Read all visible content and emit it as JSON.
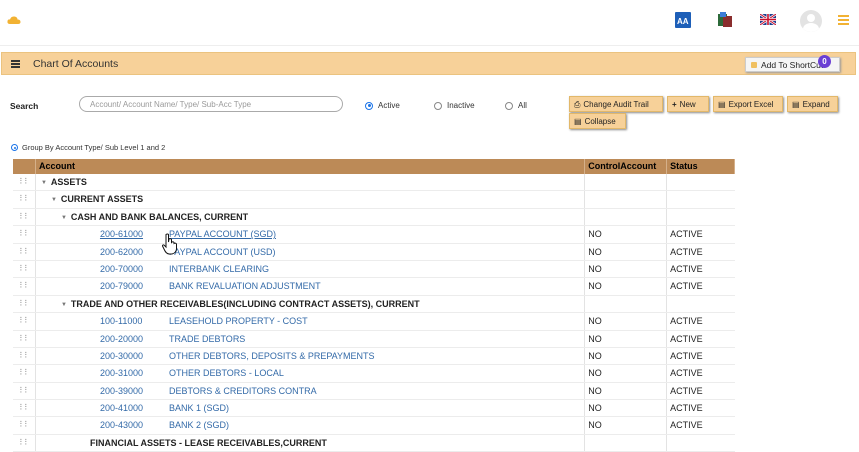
{
  "header": {
    "icons": [
      "cloud-logo-icon",
      "text-size-icon",
      "ledger-book-icon",
      "uk-flag-icon",
      "user-avatar-icon",
      "menu-icon"
    ]
  },
  "titlebar": {
    "title": "Chart Of Accounts",
    "shortcut_label": "Add To ShortCut",
    "shortcut_badge": "0"
  },
  "search": {
    "label": "Search",
    "placeholder": "Account/ Account Name/ Type/ Sub-Acc Type",
    "options": [
      "Active",
      "Inactive",
      "All"
    ],
    "selected": "Active"
  },
  "actions": {
    "audit": "Change Audit Trail",
    "new": "New",
    "export": "Export Excel",
    "expand": "Expand",
    "collapse": "Collapse"
  },
  "groupby": "Group By Account Type/ Sub Level 1 and 2",
  "table": {
    "headers": [
      "Account",
      "ControlAccount",
      "Status"
    ],
    "rows": [
      {
        "level": 0,
        "group": true,
        "label": "ASSETS"
      },
      {
        "level": 1,
        "group": true,
        "label": "CURRENT ASSETS"
      },
      {
        "level": 2,
        "group": true,
        "label": "CASH AND BANK BALANCES, CURRENT"
      },
      {
        "level": 3,
        "code": "200-61000",
        "name": "PAYPAL ACCOUNT (SGD)",
        "control": "NO",
        "status": "ACTIVE"
      },
      {
        "level": 3,
        "code": "200-62000",
        "name": "PAYPAL ACCOUNT (USD)",
        "control": "NO",
        "status": "ACTIVE"
      },
      {
        "level": 3,
        "code": "200-70000",
        "name": "INTERBANK CLEARING",
        "control": "NO",
        "status": "ACTIVE"
      },
      {
        "level": 3,
        "code": "200-79000",
        "name": "BANK REVALUATION ADJUSTMENT",
        "control": "NO",
        "status": "ACTIVE"
      },
      {
        "level": 2,
        "group": true,
        "label": "TRADE AND OTHER RECEIVABLES(INCLUDING CONTRACT ASSETS), CURRENT"
      },
      {
        "level": 3,
        "code": "100-11000",
        "name": "LEASEHOLD PROPERTY - COST",
        "control": "NO",
        "status": "ACTIVE"
      },
      {
        "level": 3,
        "code": "200-20000",
        "name": "TRADE DEBTORS",
        "control": "NO",
        "status": "ACTIVE"
      },
      {
        "level": 3,
        "code": "200-30000",
        "name": "OTHER DEBTORS, DEPOSITS & PREPAYMENTS",
        "control": "NO",
        "status": "ACTIVE"
      },
      {
        "level": 3,
        "code": "200-31000",
        "name": "OTHER DEBTORS - LOCAL",
        "control": "NO",
        "status": "ACTIVE"
      },
      {
        "level": 3,
        "code": "200-39000",
        "name": "DEBTORS & CREDITORS CONTRA",
        "control": "NO",
        "status": "ACTIVE"
      },
      {
        "level": 3,
        "code": "200-41000",
        "name": "BANK 1 (SGD)",
        "control": "NO",
        "status": "ACTIVE"
      },
      {
        "level": 3,
        "code": "200-43000",
        "name": "BANK 2 (SGD)",
        "control": "NO",
        "status": "ACTIVE"
      },
      {
        "level": 2,
        "group": true,
        "nocaret": true,
        "label": "FINANCIAL ASSETS - LEASE RECEIVABLES,CURRENT"
      }
    ]
  },
  "colors": {
    "accent": "#f7d199",
    "header_bg": "#bc8a57",
    "link": "#336aa8",
    "radio": "#1a73e8",
    "badge": "#6b3fd4"
  }
}
